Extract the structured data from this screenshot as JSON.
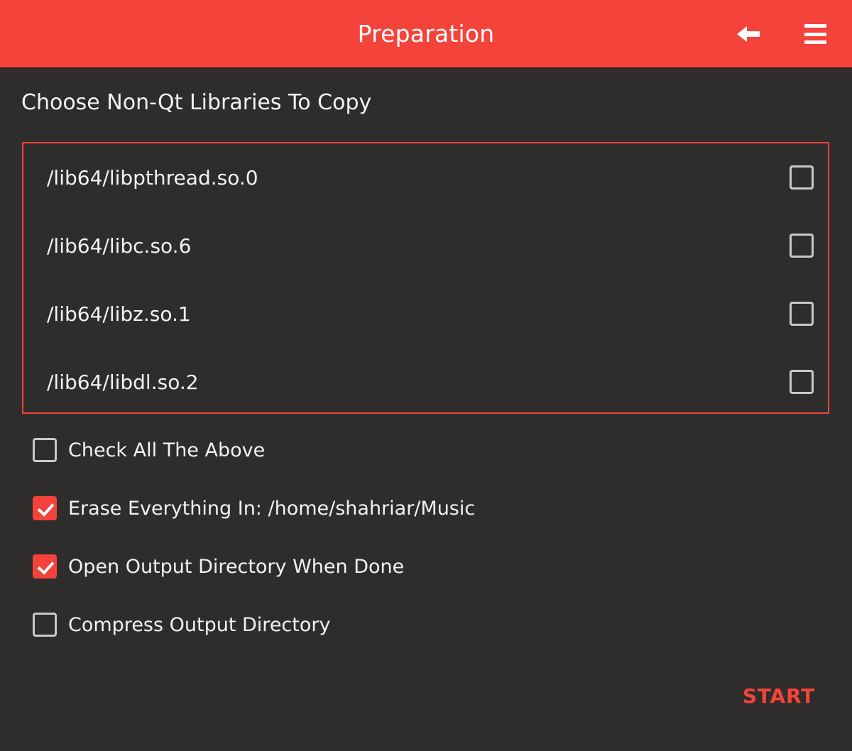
{
  "appbar": {
    "title": "Preparation",
    "back_icon": "arrow-left-icon",
    "menu_icon": "hamburger-menu-icon",
    "background_color": "#f4433a",
    "text_color": "#ffffff"
  },
  "theme": {
    "background_color": "#2e2d2c",
    "accent_color": "#f4433a",
    "text_color": "#f2f2f2",
    "checkbox_border_color": "#c9c9c9"
  },
  "section": {
    "heading": "Choose Non-Qt Libraries To Copy"
  },
  "library_list": {
    "items": [
      {
        "path": "/lib64/libpthread.so.0",
        "checked": false
      },
      {
        "path": "/lib64/libc.so.6",
        "checked": false
      },
      {
        "path": "/lib64/libz.so.1",
        "checked": false
      },
      {
        "path": "/lib64/libdl.so.2",
        "checked": false
      }
    ]
  },
  "options": [
    {
      "label": "Check All The Above",
      "checked": false
    },
    {
      "label": "Erase Everything In: /home/shahriar/Music",
      "checked": true
    },
    {
      "label": "Open Output Directory When Done",
      "checked": true
    },
    {
      "label": "Compress Output Directory",
      "checked": false
    }
  ],
  "actions": {
    "start_label": "START"
  }
}
